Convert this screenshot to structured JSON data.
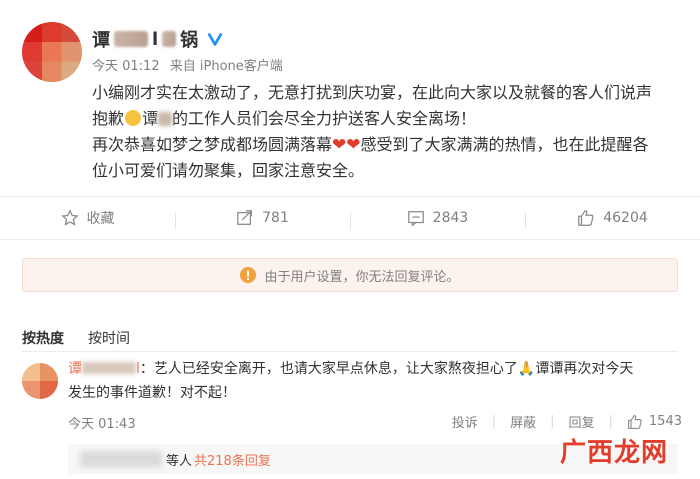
{
  "post": {
    "username_left": "谭",
    "username_right": "锅",
    "username_mid": "l",
    "time": "今天 01:12",
    "source": "来自 iPhone客户端",
    "lines": [
      "小编刚才实在太激动了，无意打扰到庆功宴，在此向大家以及就餐的客人们说声",
      "抱歉",
      "谭",
      "的工作人员们会尽全力护送客人安全离场！",
      "再次恭喜如梦之梦成都场圆满落幕",
      "感受到了大家满满的热情，也在此提醒各",
      "位小可爱们请勿聚集，回家注意安全。"
    ],
    "emoji_hearts": "❤❤"
  },
  "actions": {
    "favorite_label": "收藏",
    "share_count": "781",
    "comment_count": "2843",
    "like_count": "46204"
  },
  "notice": {
    "text": "由于用户设置，你无法回复评论。"
  },
  "sort": {
    "hot": "按热度",
    "time": "按时间"
  },
  "comment": {
    "commenter_prefix": "谭",
    "commenter_suffix": "l",
    "line1_text": "：艺人已经安全离开，也请大家早点休息，让大家熬夜担心了",
    "line1_tail": "谭谭再次对今天",
    "line2": "发生的事件道歉！对不起！",
    "time": "今天 01:43",
    "report": "投诉",
    "block": "屏蔽",
    "reply": "回复",
    "like_count": "1543",
    "replies_suffix": "等人",
    "replies_link": "共218条回复"
  },
  "watermark": {
    "text": "广西龙网"
  },
  "colors": {
    "accent": "#eb7350",
    "verified": "#1e90ff",
    "heart": "#e23b2c",
    "notice_bg": "#fdf3ee"
  }
}
